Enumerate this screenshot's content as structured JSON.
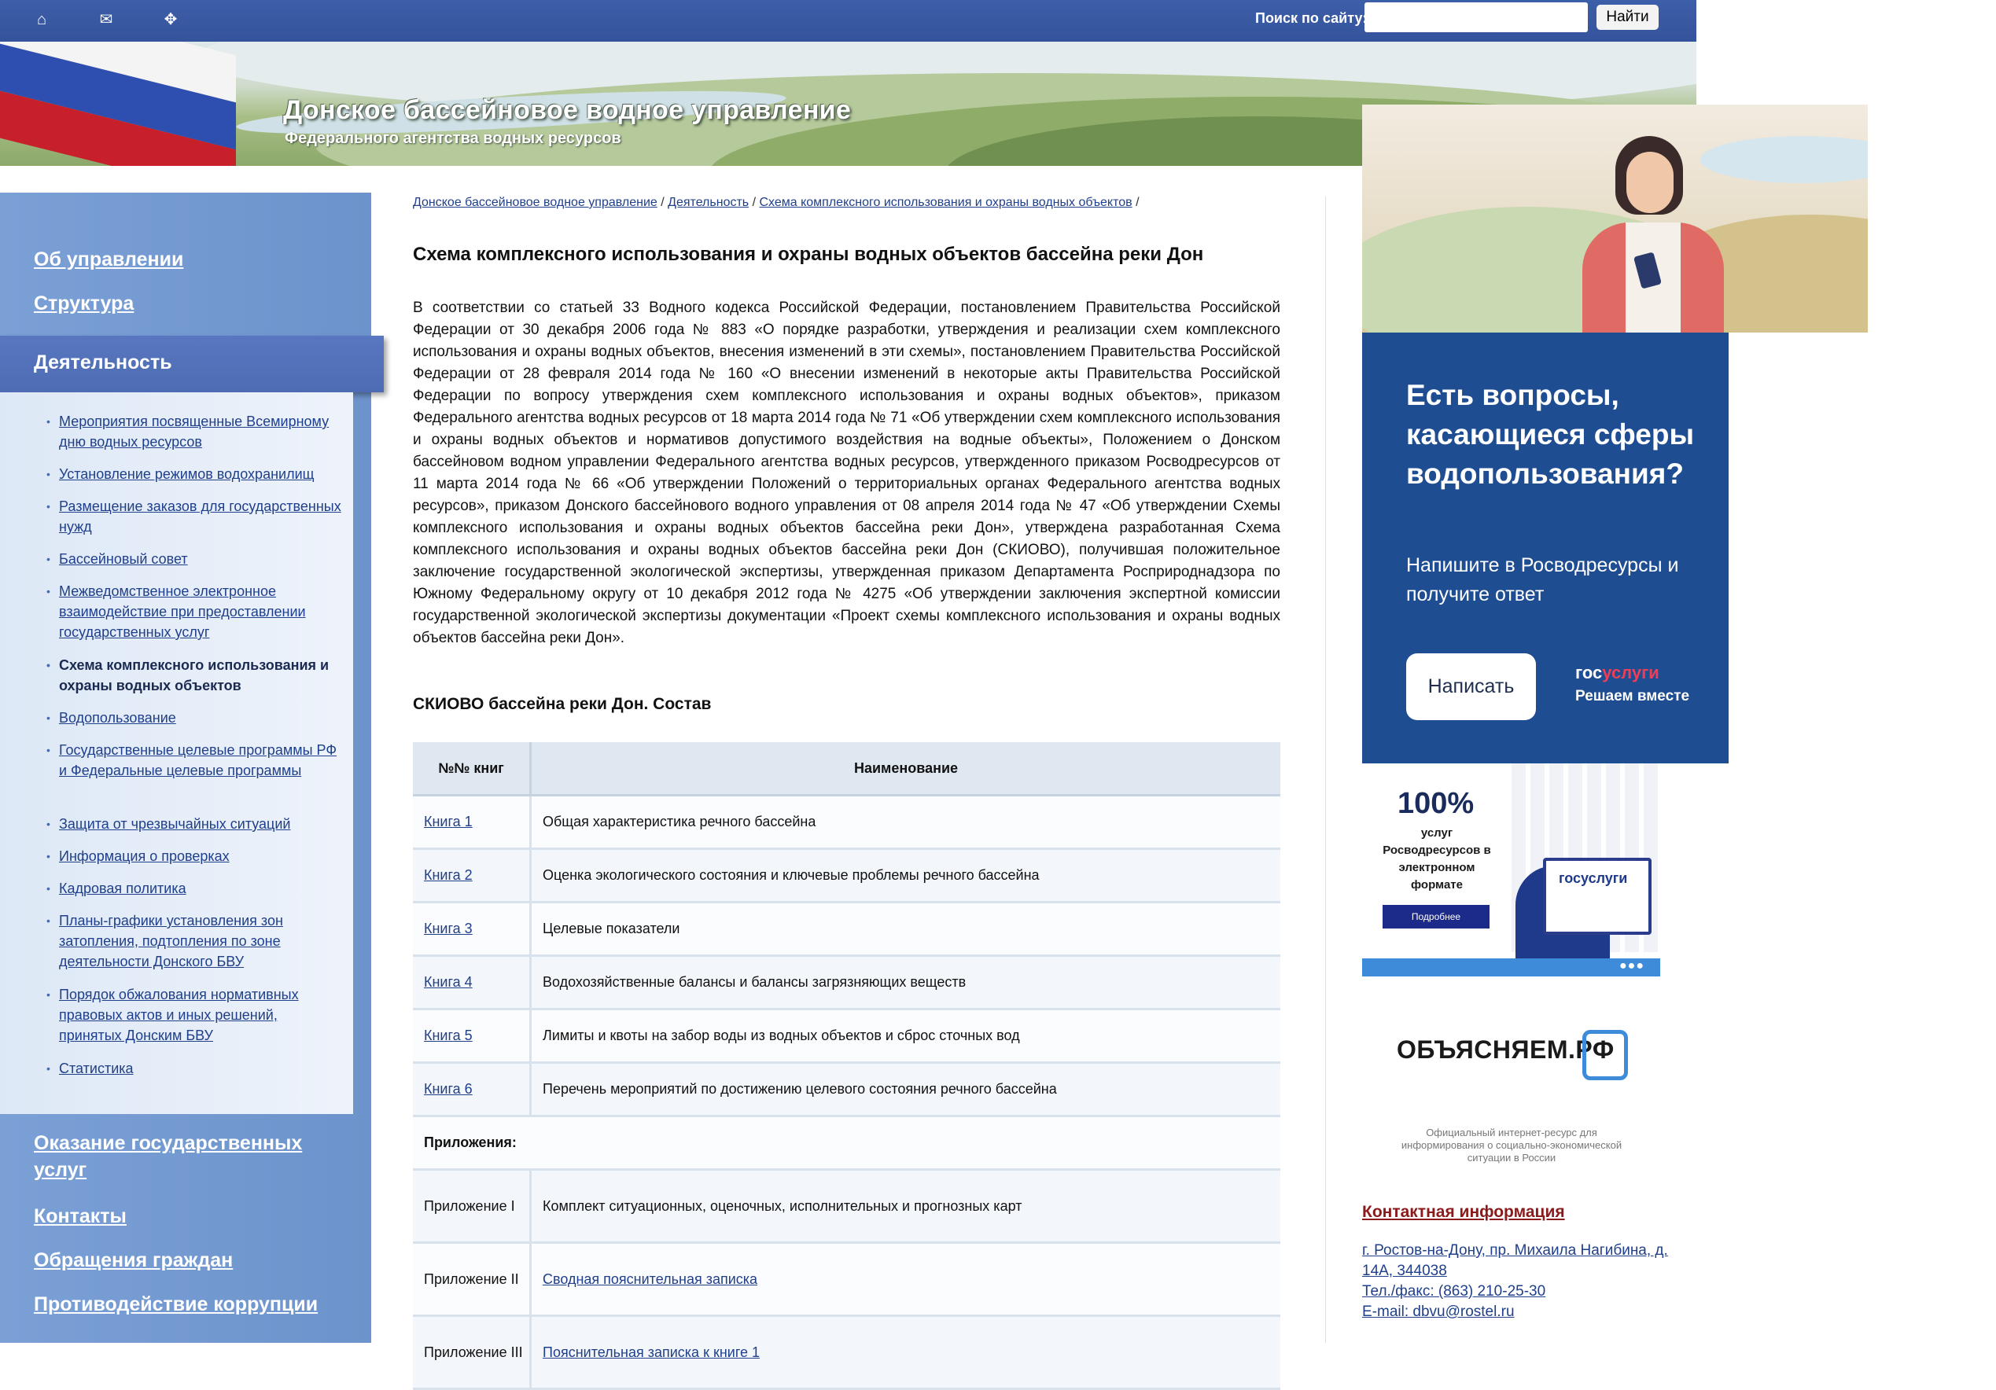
{
  "header": {
    "icons": [
      "home-icon",
      "mail-icon",
      "sitemap-icon"
    ],
    "search_label": "Поиск по сайту:",
    "search_value": "",
    "search_button": "Найти"
  },
  "banner": {
    "title": "Донское бассейновое водное управление",
    "subtitle": "Федерального агентства водных ресурсов"
  },
  "sidebar": {
    "top_items": [
      "Об управлении",
      "Структура"
    ],
    "active_item": "Деятельность",
    "sub_items": [
      "Мероприятия посвященные Всемирному дню водных ресурсов",
      "Установление режимов водохранилищ",
      "Размещение заказов для государственных нужд",
      "Бассейновый совет",
      "Межведомственное электронное взаимодействие при предоставлении государственных услуг",
      "Схема комплексного использования и охраны водных объектов",
      "Водопользование",
      "Государственные целевые программы РФ и Федеральные целевые программы",
      "Защита от чрезвычайных ситуаций",
      "Информация о проверках",
      "Кадровая политика",
      "Планы-графики установления зон затопления, подтопления по зоне деятельности Донского БВУ",
      "Порядок обжалования нормативных правовых актов и иных решений, принятых Донским БВУ",
      "Статистика"
    ],
    "bottom_items": [
      "Оказание государственных услуг",
      "Контакты",
      "Обращения граждан",
      "Противодействие коррупции"
    ]
  },
  "breadcrumb": {
    "items": [
      "Донское бассейновое водное управление",
      "Деятельность",
      "Схема комплексного использования и охраны водных объектов"
    ],
    "separator": "/"
  },
  "main": {
    "title": "Схема комплексного использования и охраны водных объектов бассейна реки Дон",
    "intro": "В соответствии со статьей 33 Водного кодекса Российской Федерации, постановлением Правительства Российской Федерации от 30 декабря 2006 года № 883 «О порядке разработки, утверждения и реализации схем комплексного использования и охраны водных объектов, внесения изменений в эти схемы», постановлением Правительства Российской Федерации от 28 февраля 2014 года № 160 «О внесении изменений в некоторые акты Правительства Российской Федерации по вопросу утверждения схем комплексного использования и охраны водных объектов», приказом Федерального агентства водных ресурсов от 18 марта 2014 года № 71 «Об утверждении схем комплексного использования и охраны водных объектов и нормативов допустимого воздействия на водные объекты», Положением о Донском бассейновом водном управлении Федерального агентства водных ресурсов, утвержденного приказом Росводресурсов от 11 марта 2014 года № 66 «Об утверждении Положений о территориальных органах Федерального агентства водных ресурсов», приказом Донского бассейнового водного управления от 08 апреля 2014 года № 47 «Об утверждении Схемы комплексного использования и охраны водных объектов бассейна реки Дон», утверждена разработанная Схема комплексного использования и охраны водных объектов бассейна реки Дон (СКИОВО), получившая положительное заключение государственной экологической экспертизы, утвержденная приказом Департамента Росприроднадзора по Южному Федеральному округу от 10 декабря 2012 года № 4275 «Об утверждении заключения экспертной комиссии государственной экологической экспертизы документации «Проект схемы комплексного использования и охраны водных объектов бассейна реки Дон».",
    "table_title": "СКИОВО бассейна реки Дон. Состав",
    "table": {
      "headers": [
        "№№ книг",
        "Наименование"
      ],
      "books": [
        {
          "book": "Книга 1",
          "name": "Общая характеристика речного бассейна"
        },
        {
          "book": "Книга 2",
          "name": "Оценка экологического состояния и ключевые проблемы речного бассейна"
        },
        {
          "book": "Книга 3",
          "name": "Целевые показатели"
        },
        {
          "book": "Книга 4",
          "name": "Водохозяйственные балансы и балансы загрязняющих веществ"
        },
        {
          "book": "Книга 5",
          "name": "Лимиты и квоты на забор воды из водных объектов и сброс сточных вод"
        },
        {
          "book": "Книга 6",
          "name": "Перечень мероприятий по достижению целевого состояния речного бассейна"
        }
      ],
      "appendix_label": "Приложения:",
      "appendices": [
        {
          "label": "Приложение I",
          "name": "Комплект ситуационных, оценочных, исполнительных и прогнозных карт",
          "link": false
        },
        {
          "label": "Приложение II",
          "name": "Сводная пояснительная записка",
          "link": true
        },
        {
          "label": "Приложение III",
          "name": "Пояснительная записка к книге 1",
          "link": true
        }
      ]
    }
  },
  "promo": {
    "heading": "Есть вопросы, касающиеся сферы водопользования?",
    "text": "Напишите в Росводресурсы и получите ответ",
    "button": "Написать",
    "logo_a": "гос",
    "logo_b": "услуги",
    "logo_sub": "Решаем вместе"
  },
  "promo2": {
    "percent": "100%",
    "text": "услуг Росводресурсов в электронном формате",
    "button": "Подробнее",
    "logo": "госуслуги"
  },
  "obyasnyaem": {
    "logo": "ОБЪЯСНЯЕМ.РФ",
    "desc": "Официальный интернет-ресурс для информирования о социально-экономической ситуации в России"
  },
  "contacts": {
    "title": "Контактная информация",
    "address": "г. Ростов-на-Дону, пр. Михаила Нагибина, д. 14А, 344038",
    "phone": "Тел./факс: (863) 210-25-30",
    "email": "E-mail: dbvu@rostel.ru"
  },
  "colors": {
    "topbar": "#3d5ea8",
    "sidebar": "#7aa0d6",
    "promo_blue": "#1f4d91",
    "link": "#1f3f8a",
    "contact_title": "#8b1b1b"
  }
}
